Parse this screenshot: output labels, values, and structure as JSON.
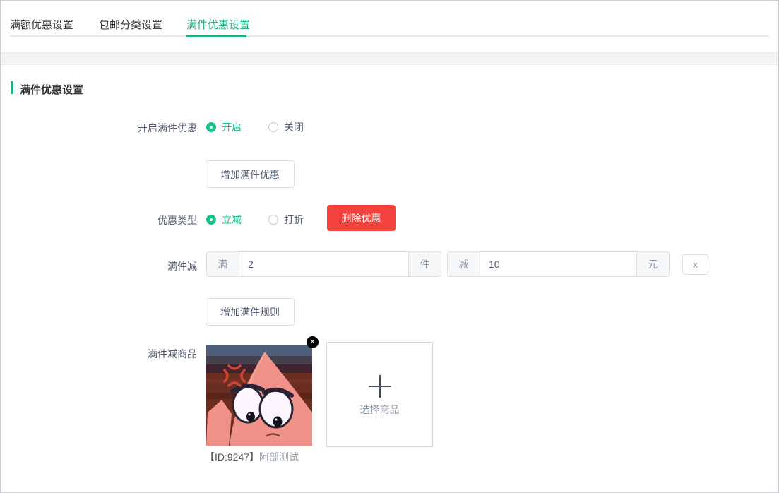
{
  "tabs": [
    {
      "label": "满额优惠设置",
      "active": false
    },
    {
      "label": "包邮分类设置",
      "active": false
    },
    {
      "label": "满件优惠设置",
      "active": true
    }
  ],
  "section": {
    "title": "满件优惠设置"
  },
  "form": {
    "enable": {
      "label": "开启满件优惠",
      "option_on": "开启",
      "option_off": "关闭"
    },
    "add_discount_button": "增加满件优惠",
    "type": {
      "label": "优惠类型",
      "option_reduce": "立减",
      "option_discount": "打折",
      "delete_button": "删除优惠"
    },
    "rule": {
      "label": "满件减",
      "prefix_qty": "满",
      "qty_value": "2",
      "suffix_qty": "件",
      "prefix_amount": "减",
      "amount_value": "10",
      "suffix_amount": "元",
      "remove_button": "x"
    },
    "add_rule_button": "增加满件规则",
    "products": {
      "label": "满件减商品",
      "item": {
        "caption_id": "【ID:9247】",
        "caption_name": "阿部测试"
      },
      "picker_label": "选择商品"
    }
  },
  "icons": {
    "close": "✕"
  },
  "colors": {
    "accent_green": "#23ab83",
    "radio_green": "#17c287",
    "danger_red": "#f3413c",
    "border_gray": "#dcdee2"
  }
}
